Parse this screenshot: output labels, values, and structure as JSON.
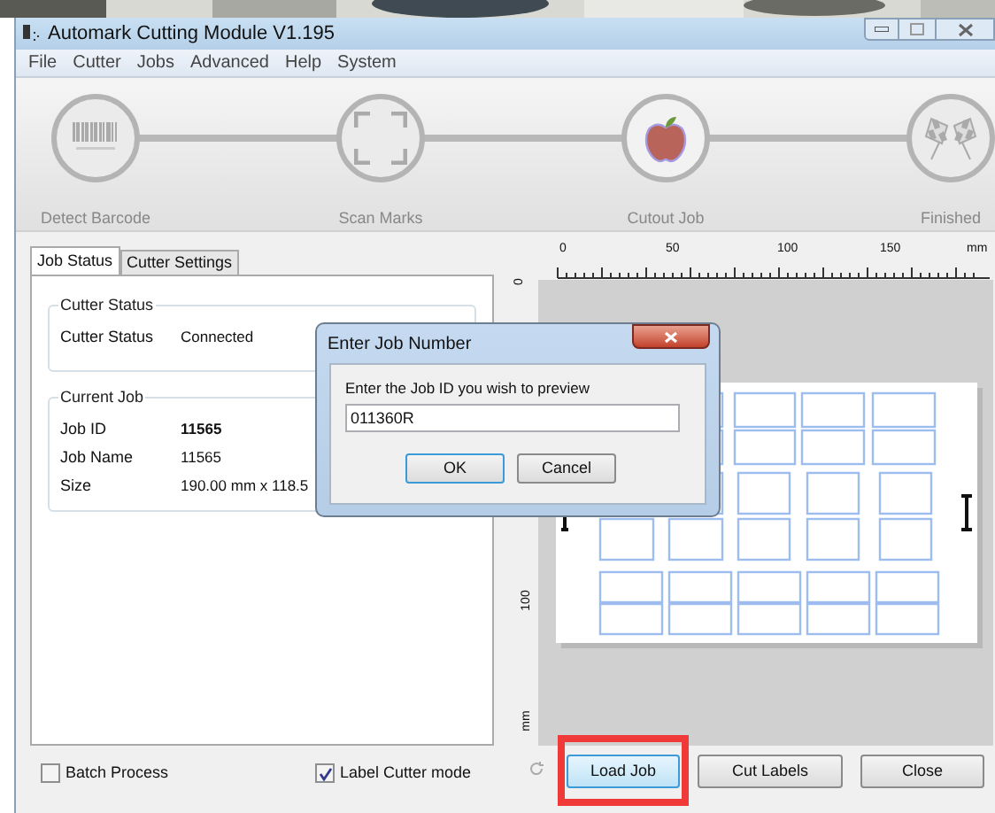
{
  "window": {
    "title": "Automark Cutting Module V1.195"
  },
  "menu": [
    "File",
    "Cutter",
    "Jobs",
    "Advanced",
    "Help",
    "System"
  ],
  "steps": [
    {
      "label": "Detect Barcode",
      "kind": "barcode",
      "selected": false
    },
    {
      "label": "Scan Marks",
      "kind": "marks",
      "selected": false
    },
    {
      "label": "Cutout Job",
      "kind": "cutout",
      "selected": true
    },
    {
      "label": "Finished",
      "kind": "finish",
      "selected": false
    }
  ],
  "tabs": [
    {
      "label": "Job Status",
      "selected": true
    },
    {
      "label": "Cutter Settings",
      "selected": false
    }
  ],
  "cutter_status": {
    "title": "Cutter Status",
    "rows": [
      {
        "label": "Cutter Status",
        "value": "Connected",
        "bold": false
      }
    ]
  },
  "current_job": {
    "title": "Current Job",
    "rows": [
      {
        "label": "Job ID",
        "value": "11565",
        "bold": true
      },
      {
        "label": "Job Name",
        "value": "11565",
        "bold": false
      },
      {
        "label": "Size",
        "value": "190.00 mm x 118.5",
        "bold": false
      }
    ]
  },
  "options": [
    {
      "label": "Batch Process",
      "checked": false
    },
    {
      "label": "Label Cutter mode",
      "checked": true
    }
  ],
  "preview": {
    "top_ruler": [
      "0",
      "50",
      "100",
      "150",
      "mm"
    ],
    "side_ruler": [
      "0",
      "100",
      "mm"
    ]
  },
  "dialog": {
    "title": "Enter Job Number",
    "prompt": "Enter the Job ID you wish to preview",
    "value": "011360R",
    "buttons": [
      "OK",
      "Cancel"
    ]
  },
  "buttons": [
    {
      "label": "Load Job",
      "highlighted": true
    },
    {
      "label": "Cut Labels",
      "highlighted": false
    },
    {
      "label": "Close",
      "highlighted": false
    }
  ]
}
